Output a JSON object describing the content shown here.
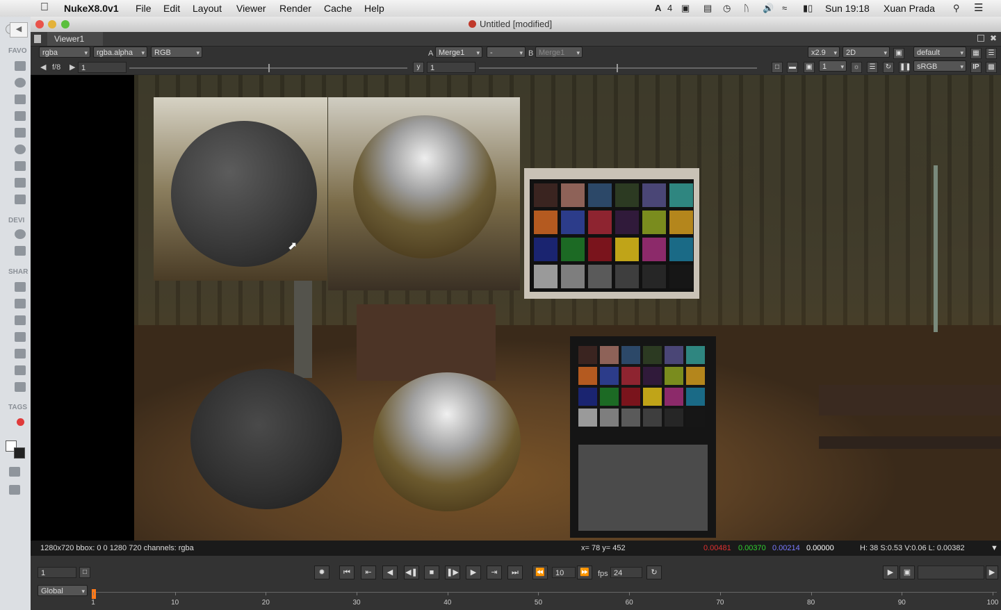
{
  "menubar": {
    "app": "NukeX8.0v1",
    "items": [
      "File",
      "Edit",
      "Layout",
      "Viewer",
      "Render",
      "Cache",
      "Help"
    ],
    "status_badge": "4",
    "clock": "Sun 19:18",
    "user": "Xuan Prada"
  },
  "finder": {
    "sections": [
      "FAVO",
      "DEVI",
      "SHAR",
      "TAGS"
    ]
  },
  "window": {
    "title": "Untitled [modified]"
  },
  "viewer_tab": "Viewer1",
  "toolbar": {
    "channels": "rgba",
    "alpha_channel": "rgba.alpha",
    "display_channels": "RGB",
    "a_label": "A",
    "input_a": "Merge1",
    "wipe_mode": "-",
    "b_label": "B",
    "input_b": "Merge1",
    "zoom": "x2.9",
    "view_mode": "2D",
    "lut_default": "default",
    "fstop": "f/8",
    "gain": "1",
    "y_label": "y",
    "gamma": "1",
    "proxy_scale": "1",
    "colorspace": "sRGB",
    "ip_label": "IP"
  },
  "info": {
    "format": "1280x720 bbox: 0 0 1280 720 channels: rgba",
    "coords": "x=   78 y= 452",
    "r": "0.00481",
    "g": "0.00370",
    "b": "0.00214",
    "a": "0.00000",
    "hsv": "H: 38 S:0.53 V:0.06  L: 0.00382"
  },
  "playback": {
    "frame": "1",
    "increment": "10",
    "fps_label": "fps",
    "fps": "24",
    "range_mode": "Global",
    "timeline_ticks": [
      "1",
      "10",
      "20",
      "30",
      "40",
      "50",
      "60",
      "70",
      "80",
      "90",
      "100"
    ]
  },
  "colors": {
    "accent_red": "#e03030",
    "accent_green": "#30d030",
    "accent_blue": "#6a6aff"
  }
}
